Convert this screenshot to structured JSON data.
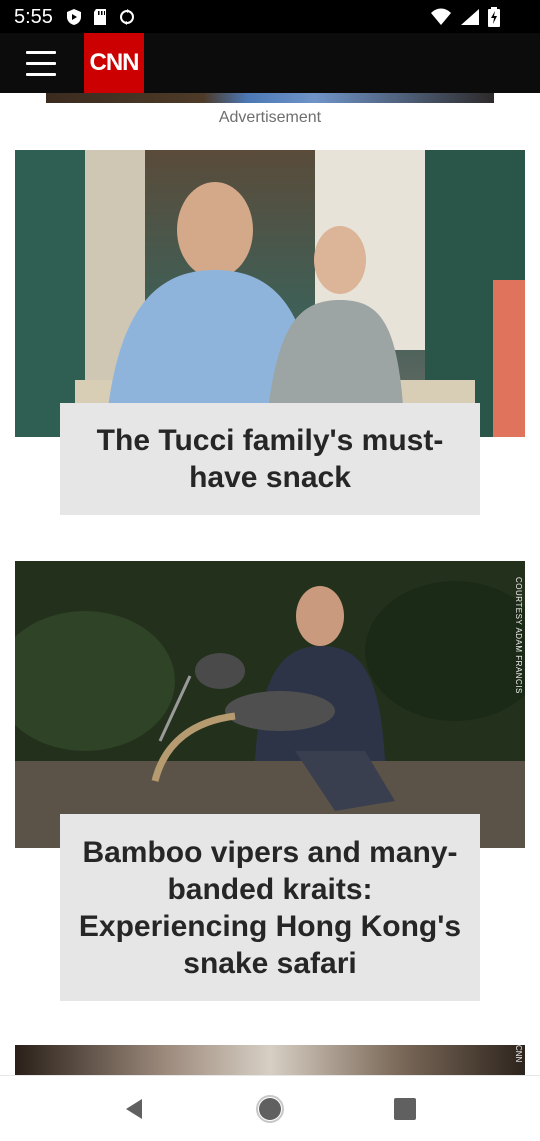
{
  "status_bar": {
    "time": "5:55",
    "left_icons": [
      "play-protect-icon",
      "sd-card-icon",
      "sync-icon"
    ],
    "right_icons": [
      "wifi-icon",
      "signal-icon",
      "battery-charging-icon"
    ]
  },
  "header": {
    "logo_text": "CNN",
    "brand_color": "#cc0000"
  },
  "content": {
    "ad_label": "Advertisement",
    "cards": [
      {
        "title": "The Tucci family's must-have snack"
      },
      {
        "title": "Bamboo vipers and many-banded kraits: Experiencing Hong Kong's snake safari",
        "credit": "COURTESY ADAM FRANCIS"
      },
      {
        "credit": "CNN"
      }
    ]
  },
  "nav_bar": {
    "items": [
      "back-icon",
      "home-icon",
      "recents-icon"
    ]
  }
}
